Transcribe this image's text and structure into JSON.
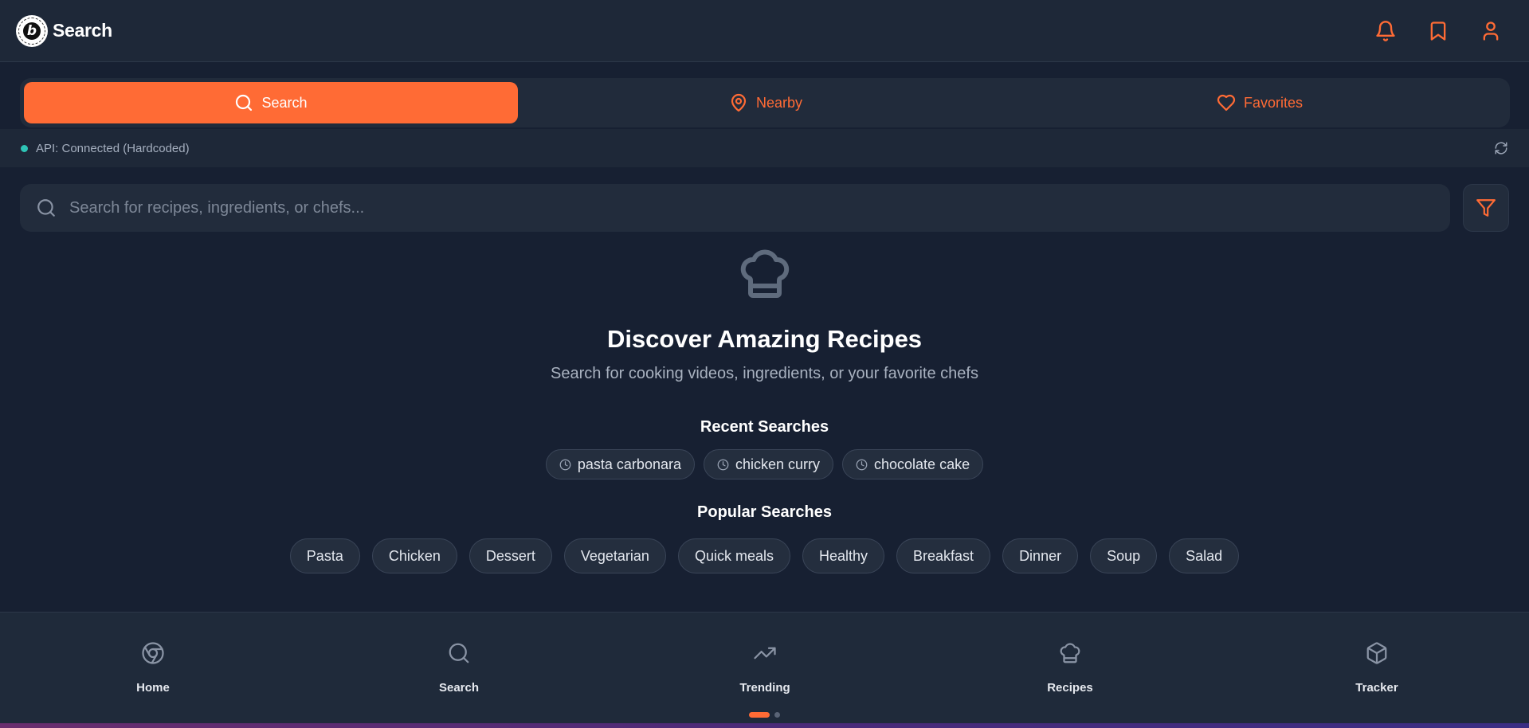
{
  "header": {
    "title": "Search",
    "icons": [
      "bell-icon",
      "bookmark-icon",
      "user-icon"
    ]
  },
  "tabs": [
    {
      "label": "Search",
      "icon": "search-icon",
      "active": true
    },
    {
      "label": "Nearby",
      "icon": "map-pin-icon",
      "active": false
    },
    {
      "label": "Favorites",
      "icon": "heart-icon",
      "active": false
    }
  ],
  "status": {
    "text": "API: Connected (Hardcoded)",
    "color": "#2ec4b6"
  },
  "search": {
    "placeholder": "Search for recipes, ingredients, or chefs...",
    "value": ""
  },
  "hero": {
    "title": "Discover Amazing Recipes",
    "subtitle": "Search for cooking videos, ingredients, or your favorite chefs"
  },
  "recent": {
    "title": "Recent Searches",
    "items": [
      "pasta carbonara",
      "chicken curry",
      "chocolate cake"
    ]
  },
  "popular": {
    "title": "Popular Searches",
    "items": [
      "Pasta",
      "Chicken",
      "Dessert",
      "Vegetarian",
      "Quick meals",
      "Healthy",
      "Breakfast",
      "Dinner",
      "Soup",
      "Salad"
    ]
  },
  "bottom_nav": [
    {
      "label": "Home",
      "icon": "chrome-icon"
    },
    {
      "label": "Search",
      "icon": "search-icon"
    },
    {
      "label": "Trending",
      "icon": "trending-up-icon"
    },
    {
      "label": "Recipes",
      "icon": "chef-hat-icon"
    },
    {
      "label": "Tracker",
      "icon": "package-icon"
    }
  ],
  "pager": {
    "pages": 2,
    "current": 1
  },
  "colors": {
    "accent": "#ff6b35",
    "background": "#172032",
    "surface": "#222c3c"
  }
}
